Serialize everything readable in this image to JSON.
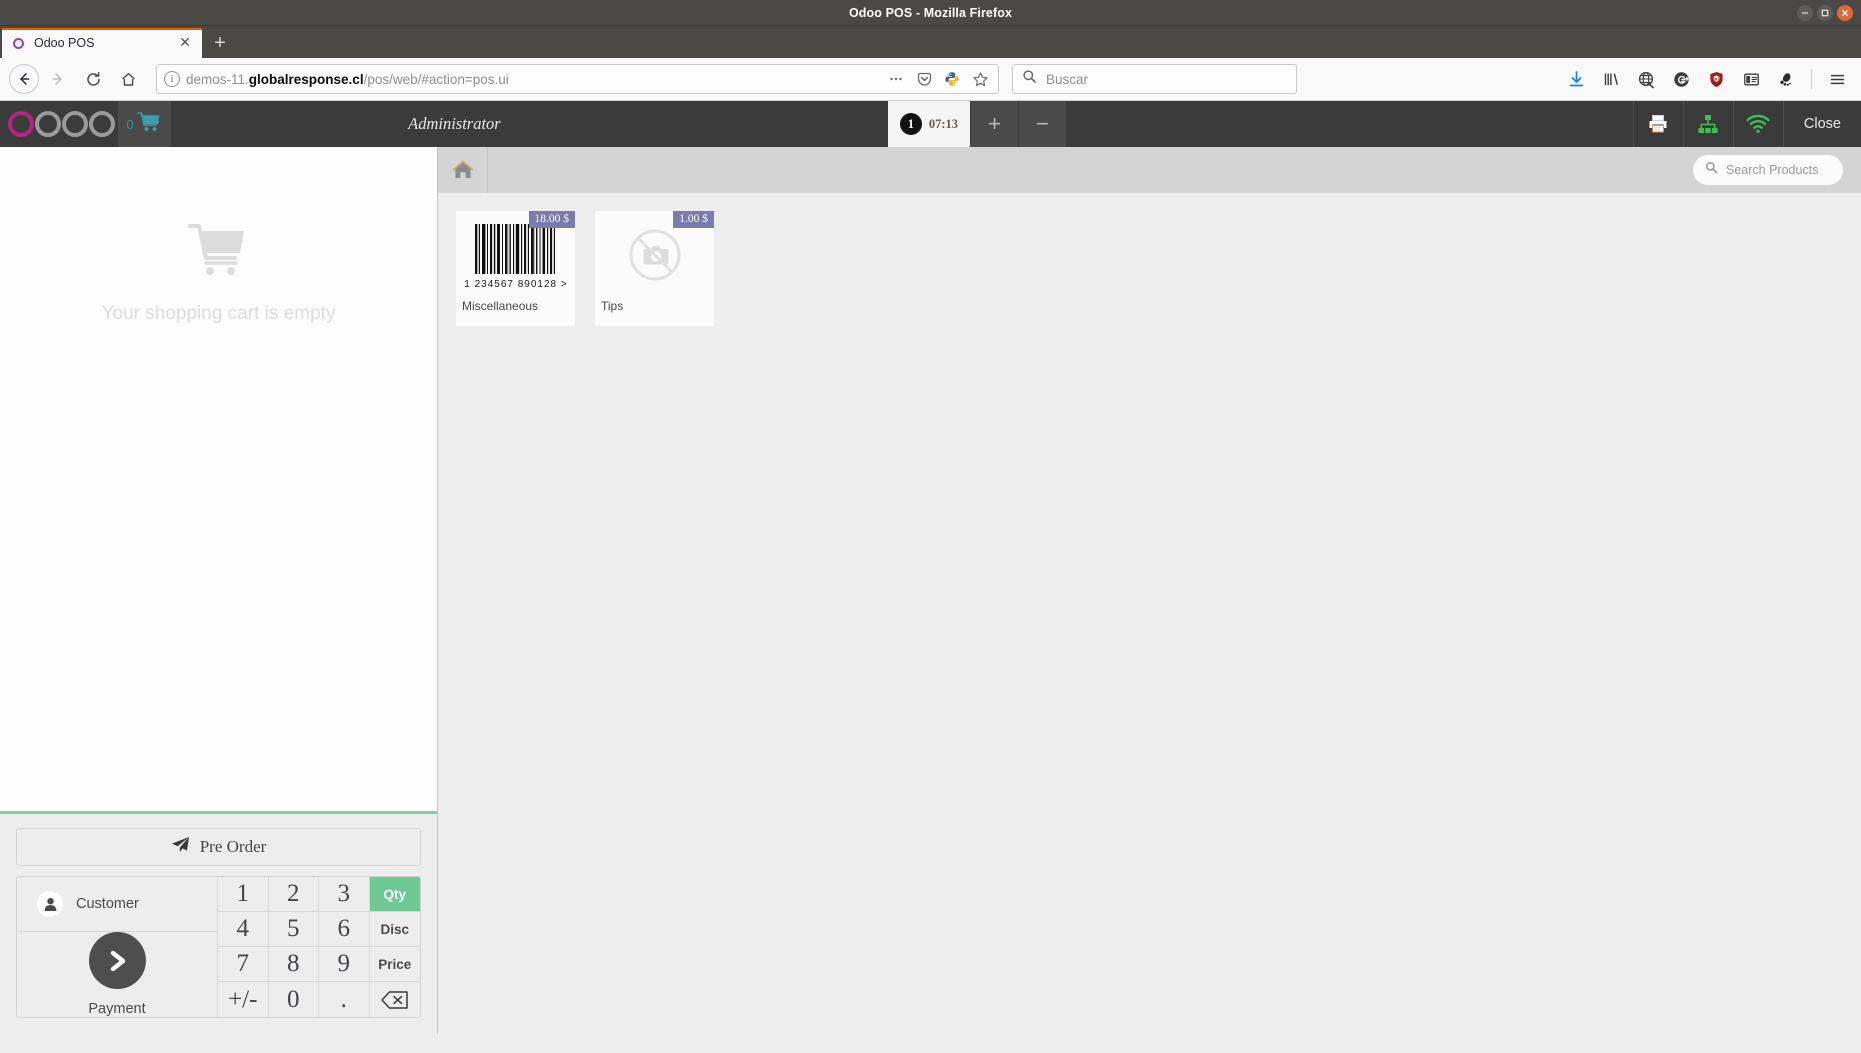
{
  "window": {
    "title": "Odoo POS - Mozilla Firefox",
    "controls": {
      "minimize": "–",
      "maximize": "□",
      "close": "×"
    }
  },
  "browser": {
    "tab": {
      "title": "Odoo POS",
      "favicon": "odoo-logo-icon",
      "close_label": "✕"
    },
    "new_tab_label": "+",
    "nav": {
      "back": "←",
      "forward": "→",
      "reload": "⟳",
      "home": "⌂"
    },
    "urlbar": {
      "info_icon": "i",
      "url_prefix": "demos-11.",
      "url_domain": "globalresponse.cl",
      "url_path": "/pos/web/#action=pos.ui",
      "full_url": "demos-11.globalresponse.cl/pos/web/#action=pos.ui",
      "page_actions_label": "•••",
      "icons": [
        "pocket-icon",
        "python-extension-icon",
        "bookmark-star-icon"
      ]
    },
    "search": {
      "placeholder": "Buscar",
      "icon": "search-icon"
    },
    "toolbar_icons": [
      "downloads-icon",
      "library-icon",
      "web-globe-icon",
      "gplus-circle-icon",
      "ublock-shield-icon",
      "reader-sidebar-icon",
      "gnome-foot-icon"
    ],
    "menu_label": "☰"
  },
  "pos": {
    "header": {
      "logo": "odoo-logo",
      "cart_count": "0",
      "cart_icon": "shopping-cart-icon",
      "user": "Administrator",
      "order_tabs": [
        {
          "number": "1",
          "time": "07:13",
          "active": true
        }
      ],
      "add_order_label": "+",
      "remove_order_label": "−",
      "icons": [
        "printer-icon",
        "network-sitemap-icon",
        "wifi-icon"
      ],
      "close_label": "Close"
    },
    "order_panel": {
      "empty_icon": "empty-cart-icon",
      "empty_text": "Your shopping cart is empty",
      "pre_order_label": "Pre Order",
      "pre_order_icon": "paper-plane-icon",
      "customer_label": "Customer",
      "customer_icon": "user-icon",
      "payment_label": "Payment",
      "payment_icon": "chevron-right-icon",
      "numpad": [
        {
          "label": "1",
          "kind": "digit"
        },
        {
          "label": "2",
          "kind": "digit"
        },
        {
          "label": "3",
          "kind": "digit"
        },
        {
          "label": "Qty",
          "kind": "mode",
          "active": true
        },
        {
          "label": "4",
          "kind": "digit"
        },
        {
          "label": "5",
          "kind": "digit"
        },
        {
          "label": "6",
          "kind": "digit"
        },
        {
          "label": "Disc",
          "kind": "mode",
          "active": false
        },
        {
          "label": "7",
          "kind": "digit"
        },
        {
          "label": "8",
          "kind": "digit"
        },
        {
          "label": "9",
          "kind": "digit"
        },
        {
          "label": "Price",
          "kind": "mode",
          "active": false
        },
        {
          "label": "+/-",
          "kind": "digit"
        },
        {
          "label": "0",
          "kind": "digit"
        },
        {
          "label": ".",
          "kind": "digit"
        },
        {
          "label": "⌫",
          "kind": "backspace"
        }
      ]
    },
    "product_panel": {
      "home_icon": "home-icon",
      "search_placeholder": "Search Products",
      "search_icon": "search-icon",
      "products": [
        {
          "name": "Miscellaneous",
          "price": "18.00 $",
          "image": "barcode-image",
          "barcode_digits": "1 234567 890128 >"
        },
        {
          "name": "Tips",
          "price": "1.00 $",
          "image": "no-image-camera-placeholder"
        }
      ]
    }
  },
  "colors": {
    "odoo_purple": "#7c7bad",
    "accent_green": "#6dc894",
    "pos_header_dark": "#3b3b3b",
    "firefox_tab_accent": "#e66000",
    "product_bg": "#ededed"
  }
}
